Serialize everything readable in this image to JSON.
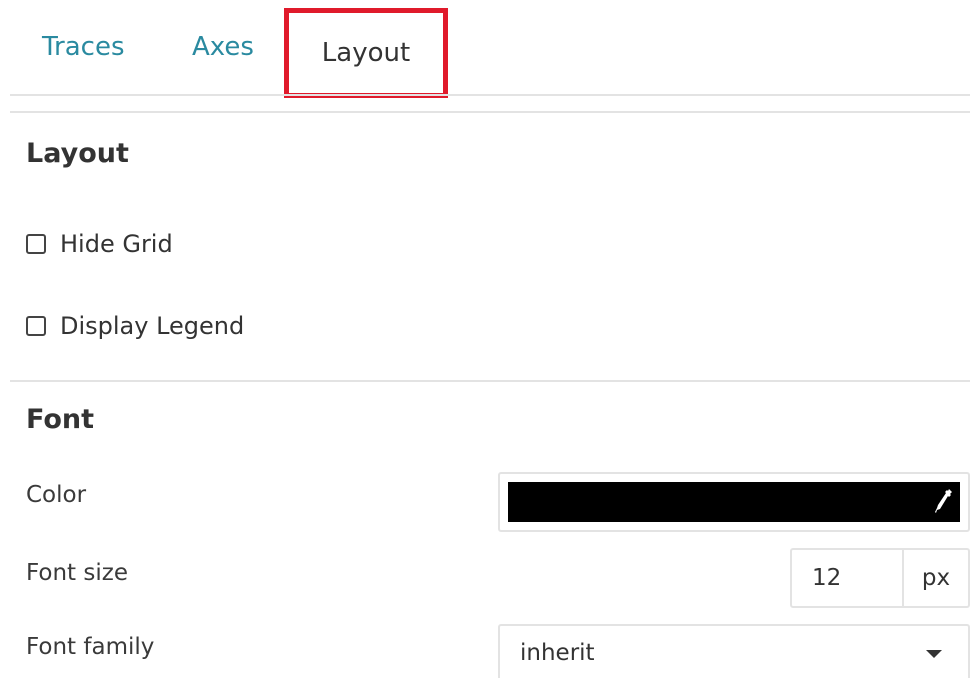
{
  "tabs": [
    {
      "label": "Traces",
      "active": false
    },
    {
      "label": "Axes",
      "active": false
    },
    {
      "label": "Layout",
      "active": true
    }
  ],
  "layout_section": {
    "title": "Layout",
    "hide_grid": {
      "label": "Hide Grid",
      "checked": false
    },
    "display_legend": {
      "label": "Display Legend",
      "checked": false
    }
  },
  "font_section": {
    "title": "Font",
    "color": {
      "label": "Color",
      "value": "#000000",
      "icon": "eyedropper-icon"
    },
    "size": {
      "label": "Font size",
      "value": "12",
      "unit": "px"
    },
    "family": {
      "label": "Font family",
      "value": "inherit",
      "icon": "caret-down-icon"
    }
  },
  "colors": {
    "active_tab_highlight": "#e01a2b",
    "inactive_tab_text": "#2a8aa0"
  }
}
